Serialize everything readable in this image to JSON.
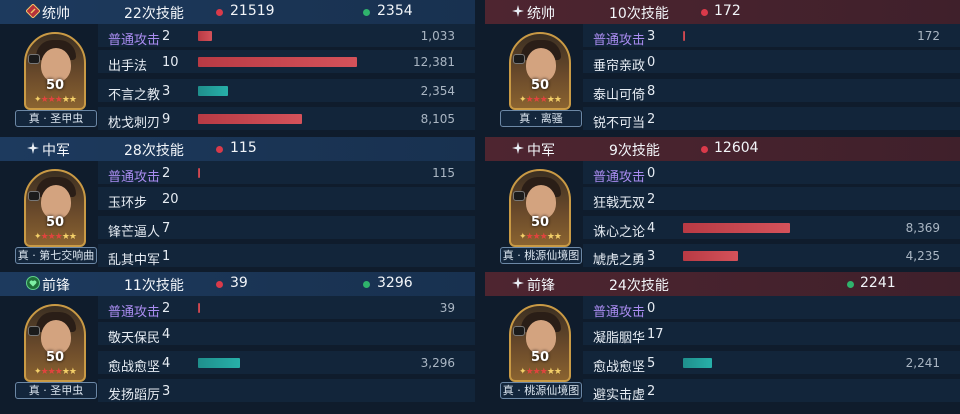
{
  "left": [
    {
      "role": "统帅",
      "role_icon": "commander-flag-icon",
      "skills": "22次技能",
      "damage": "21519",
      "heal": "2354",
      "title": "真 · 圣甲虫",
      "level": "50",
      "rows": [
        {
          "label": "普通攻击",
          "count": "2",
          "value": "1,033",
          "fraction": 0.055,
          "color": "red"
        },
        {
          "label": "出手法",
          "count": "10",
          "value": "12,381",
          "fraction": 0.61,
          "color": "red"
        },
        {
          "label": "不言之教",
          "count": "3",
          "value": "2,354",
          "fraction": 0.115,
          "color": "teal"
        },
        {
          "label": "枕戈刺刃",
          "count": "9",
          "value": "8,105",
          "fraction": 0.4,
          "color": "red"
        }
      ]
    },
    {
      "role": "中军",
      "role_icon": "sparkle-icon",
      "skills": "28次技能",
      "damage": "115",
      "heal": "",
      "title": "真 · 第七交响曲",
      "level": "50",
      "rows": [
        {
          "label": "普通攻击",
          "count": "2",
          "value": "115",
          "fraction": 0.006,
          "color": "red"
        },
        {
          "label": "玉环步",
          "count": "20",
          "value": "",
          "fraction": 0,
          "color": "red"
        },
        {
          "label": "锋芒逼人",
          "count": "7",
          "value": "",
          "fraction": 0,
          "color": "red"
        },
        {
          "label": "乱其中军",
          "count": "1",
          "value": "",
          "fraction": 0,
          "color": "red"
        }
      ]
    },
    {
      "role": "前锋",
      "role_icon": "heart-shield-icon",
      "skills": "11次技能",
      "damage": "39",
      "heal": "3296",
      "title": "真 · 圣甲虫",
      "level": "50",
      "rows": [
        {
          "label": "普通攻击",
          "count": "2",
          "value": "39",
          "fraction": 0.004,
          "color": "red"
        },
        {
          "label": "敬天保民",
          "count": "4",
          "value": "",
          "fraction": 0,
          "color": "red"
        },
        {
          "label": "愈战愈坚",
          "count": "4",
          "value": "3,296",
          "fraction": 0.16,
          "color": "teal"
        },
        {
          "label": "发扬蹈厉",
          "count": "3",
          "value": "",
          "fraction": 0,
          "color": "red"
        }
      ]
    }
  ],
  "right": [
    {
      "role": "统帅",
      "role_icon": "sparkle-icon",
      "skills": "10次技能",
      "damage": "172",
      "heal": "",
      "title": "真 · 离骚",
      "level": "50",
      "rows": [
        {
          "label": "普通攻击",
          "count": "3",
          "value": "172",
          "fraction": 0.006,
          "color": "red"
        },
        {
          "label": "垂帘亲政",
          "count": "0",
          "value": "",
          "fraction": 0,
          "color": "red"
        },
        {
          "label": "泰山可倚",
          "count": "8",
          "value": "",
          "fraction": 0,
          "color": "red"
        },
        {
          "label": "锐不可当",
          "count": "2",
          "value": "",
          "fraction": 0,
          "color": "red"
        }
      ]
    },
    {
      "role": "中军",
      "role_icon": "sparkle-icon",
      "skills": "9次技能",
      "damage": "12604",
      "heal": "",
      "title": "真 · 桃源仙境图",
      "level": "50",
      "rows": [
        {
          "label": "普通攻击",
          "count": "0",
          "value": "",
          "fraction": 0,
          "color": "red"
        },
        {
          "label": "狂戟无双",
          "count": "2",
          "value": "",
          "fraction": 0,
          "color": "red"
        },
        {
          "label": "诛心之论",
          "count": "4",
          "value": "8,369",
          "fraction": 0.41,
          "color": "red"
        },
        {
          "label": "虓虎之勇",
          "count": "3",
          "value": "4,235",
          "fraction": 0.21,
          "color": "red"
        }
      ]
    },
    {
      "role": "前锋",
      "role_icon": "sparkle-icon",
      "skills": "24次技能",
      "damage": "",
      "heal": "2241",
      "title": "真 · 桃源仙境图",
      "level": "50",
      "rows": [
        {
          "label": "普通攻击",
          "count": "0",
          "value": "",
          "fraction": 0,
          "color": "red"
        },
        {
          "label": "凝脂胭华",
          "count": "17",
          "value": "",
          "fraction": 0,
          "color": "red"
        },
        {
          "label": "愈战愈坚",
          "count": "5",
          "value": "2,241",
          "fraction": 0.11,
          "color": "teal"
        },
        {
          "label": "避实击虚",
          "count": "2",
          "value": "",
          "fraction": 0,
          "color": "red"
        }
      ]
    }
  ],
  "colors": {
    "damage_dot": "#d93a4a",
    "heal_dot": "#2fb36c",
    "basic_attack_text": "#a98cf0",
    "teal_bar": "#27b0a9",
    "red_bar": "#d4525a"
  }
}
